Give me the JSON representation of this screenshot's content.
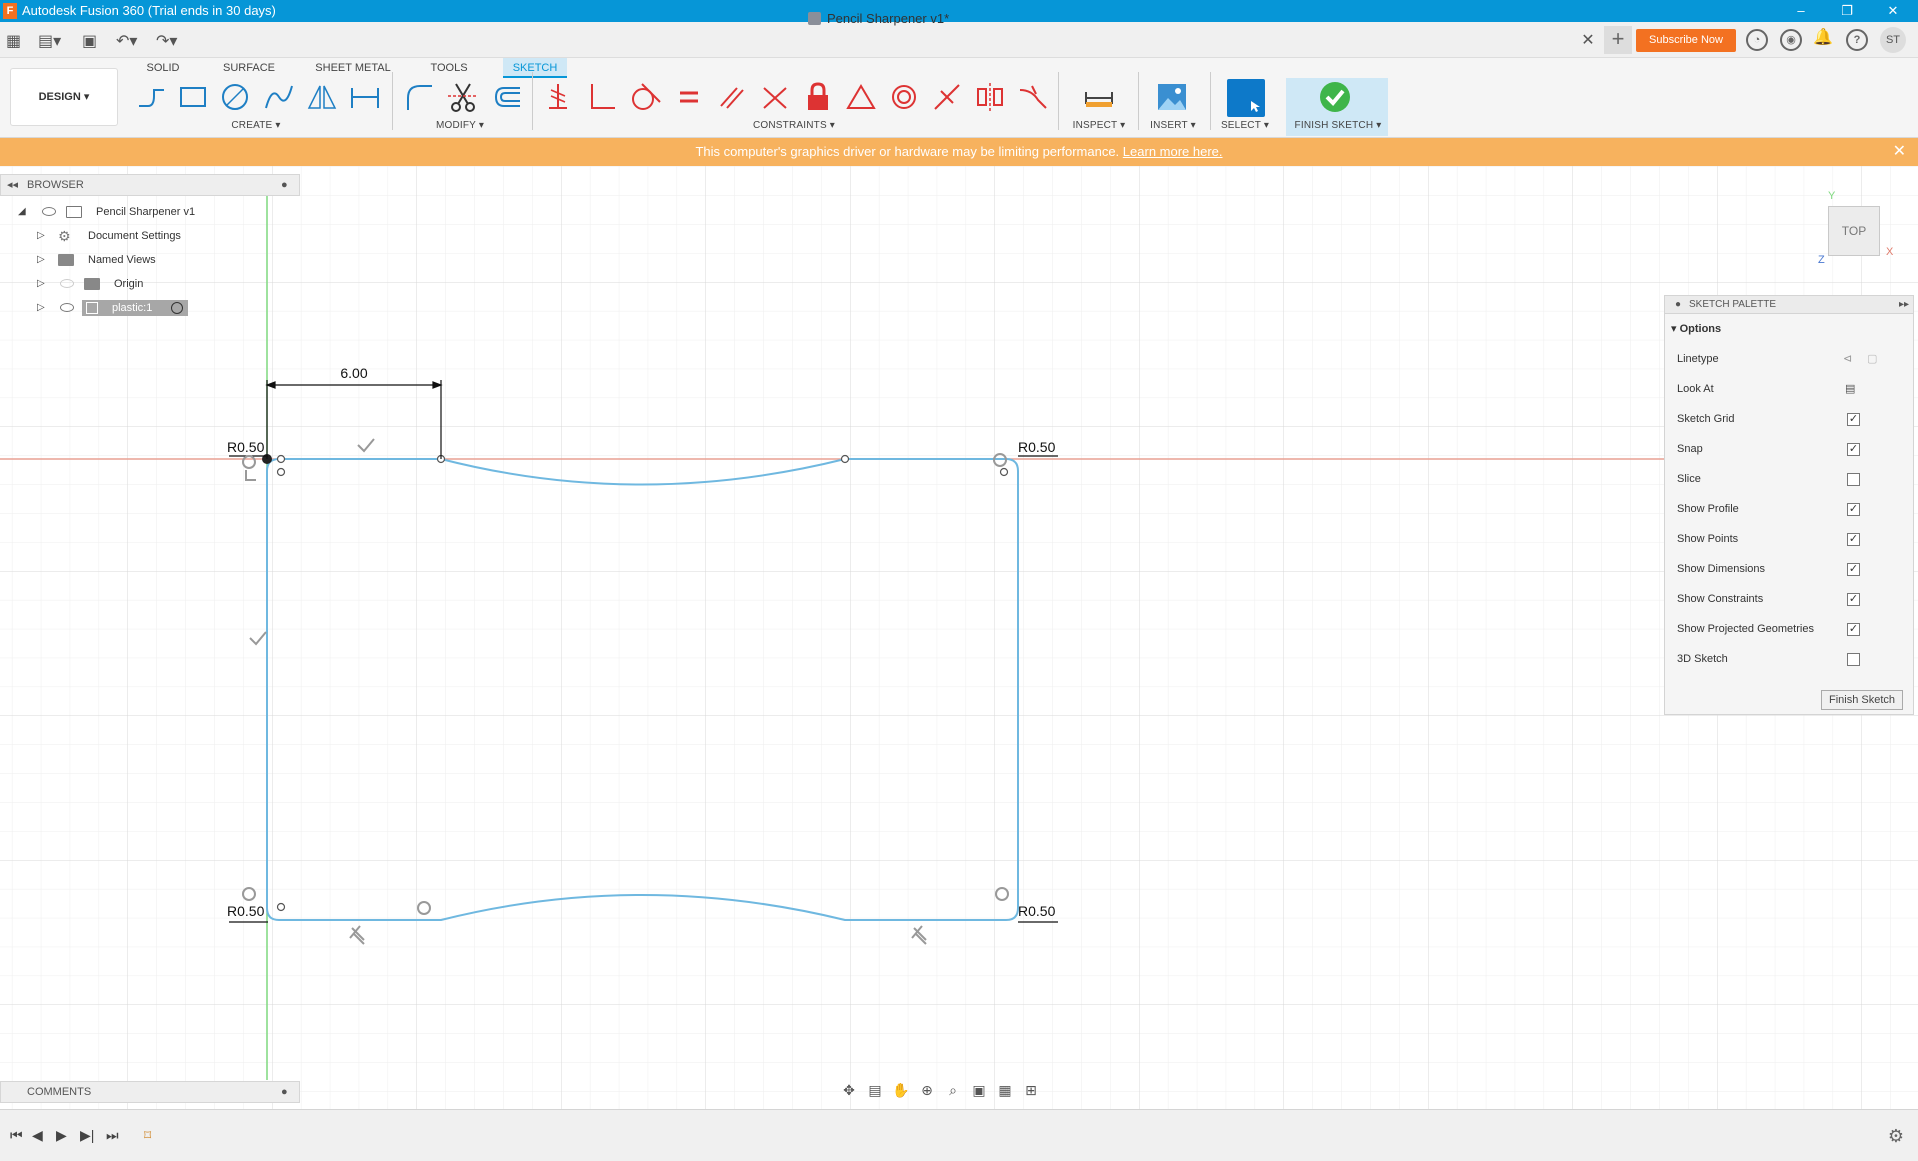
{
  "app": {
    "title": "Autodesk Fusion 360 (Trial ends in 30 days)",
    "logo_letter": "F"
  },
  "header": {
    "doc_tab": "Pencil Sharpener v1*",
    "subscribe": "Subscribe Now",
    "avatar": "ST"
  },
  "toolbar": {
    "workspace": "DESIGN ▾",
    "tabs": [
      {
        "label": "SOLID"
      },
      {
        "label": "SURFACE"
      },
      {
        "label": "SHEET METAL"
      },
      {
        "label": "TOOLS"
      },
      {
        "label": "SKETCH"
      }
    ],
    "active_tab": "SKETCH",
    "groups": {
      "create": "CREATE ▾",
      "modify": "MODIFY ▾",
      "constraints": "CONSTRAINTS ▾",
      "inspect": "INSPECT ▾",
      "insert": "INSERT ▾",
      "select": "SELECT ▾",
      "finish": "FINISH SKETCH ▾"
    }
  },
  "banner": {
    "message": "This computer's graphics driver or hardware may be limiting performance.",
    "link": "Learn more here."
  },
  "browser": {
    "title": "BROWSER",
    "items": [
      {
        "label": "Pencil Sharpener v1"
      },
      {
        "label": "Document Settings"
      },
      {
        "label": "Named Views"
      },
      {
        "label": "Origin"
      },
      {
        "label": "plastic:1"
      }
    ]
  },
  "comments": {
    "title": "COMMENTS"
  },
  "viewcube": {
    "face": "TOP",
    "axis_x": "X",
    "axis_y": "Y",
    "axis_z": "Z"
  },
  "sketch": {
    "dimension": "6.00",
    "radius_tl": "R0.50",
    "radius_tr": "R0.50",
    "radius_bl": "R0.50",
    "radius_br": "R0.50"
  },
  "palette": {
    "title": "SKETCH PALETTE",
    "section": "Options",
    "rows": [
      {
        "label": "Linetype"
      },
      {
        "label": "Look At"
      },
      {
        "label": "Sketch Grid",
        "checked": true
      },
      {
        "label": "Snap",
        "checked": true
      },
      {
        "label": "Slice",
        "checked": false
      },
      {
        "label": "Show Profile",
        "checked": true
      },
      {
        "label": "Show Points",
        "checked": true
      },
      {
        "label": "Show Dimensions",
        "checked": true
      },
      {
        "label": "Show Constraints",
        "checked": true
      },
      {
        "label": "Show Projected Geometries",
        "checked": true
      },
      {
        "label": "3D Sketch",
        "checked": false
      }
    ],
    "finish_button": "Finish Sketch"
  },
  "colors": {
    "titlebar": "#0696d7",
    "banner": "#f7b25e",
    "sketch_line": "#6fb8e0",
    "x_axis": "#e07b6b",
    "y_axis": "#5fd16a",
    "subscribe": "#f37121"
  }
}
